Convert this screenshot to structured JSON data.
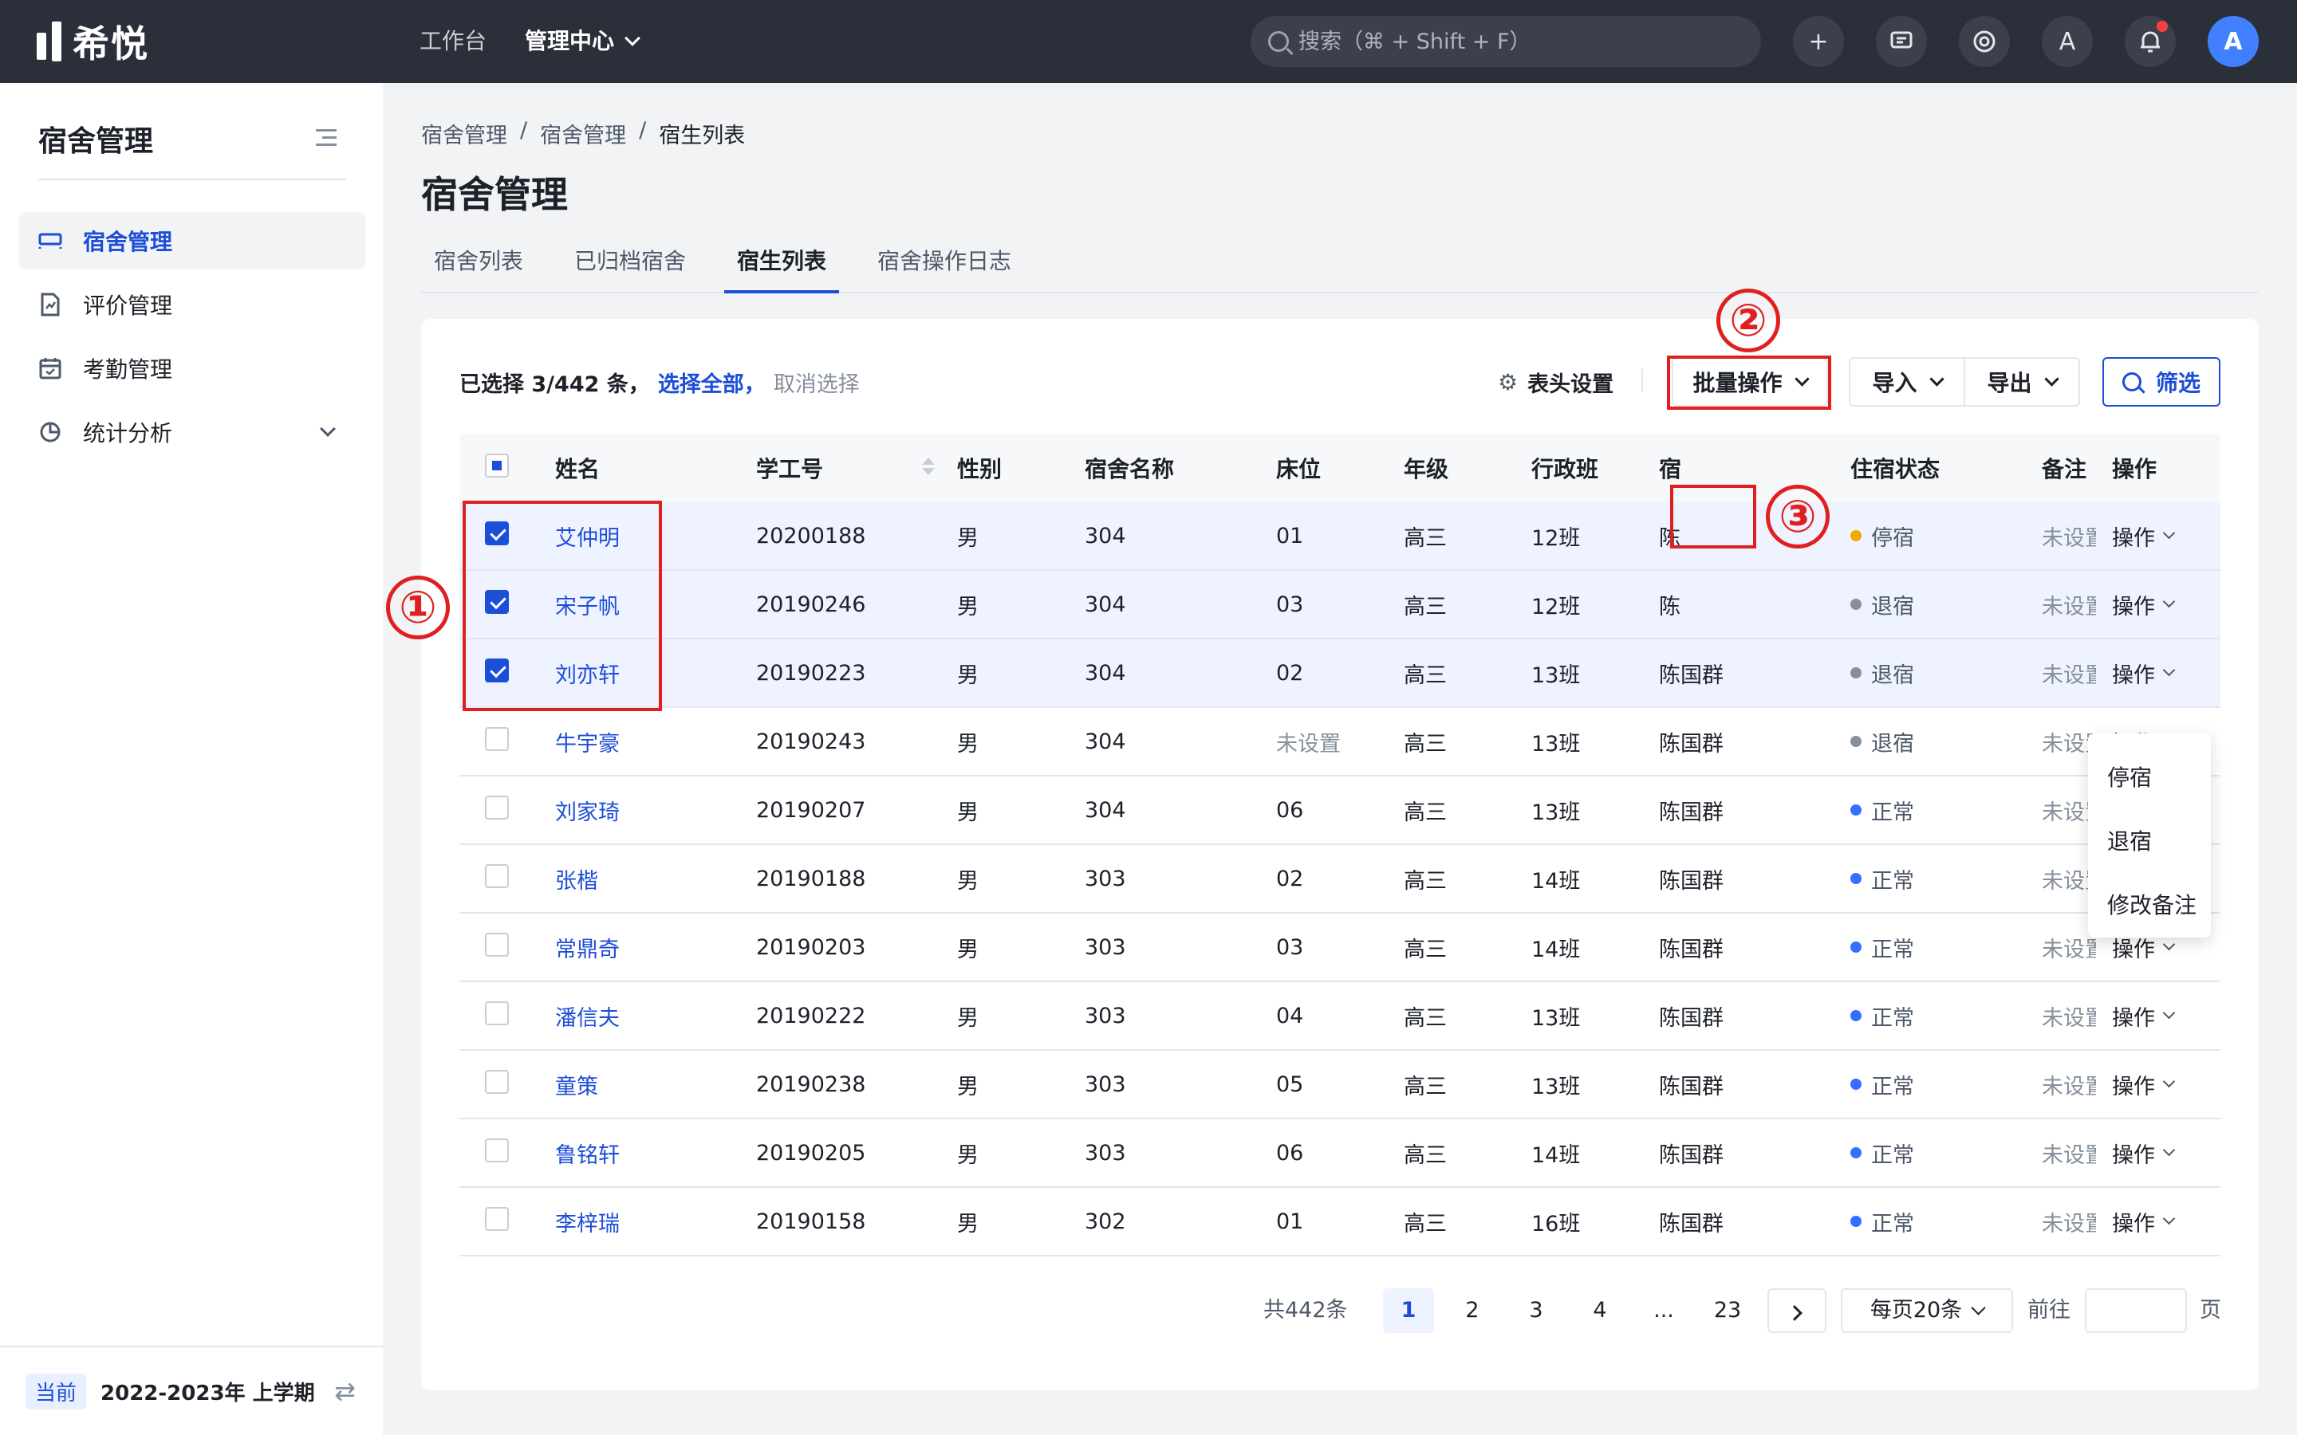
{
  "app": {
    "logo_text": "希悦"
  },
  "topnav": {
    "workbench": "工作台",
    "admin_center": "管理中心"
  },
  "search": {
    "placeholder": "搜索（⌘ + Shift + F）"
  },
  "top_icons": {
    "add": "+",
    "chat": "▭",
    "help": "⊙",
    "translate": "A",
    "bell": "🔔",
    "avatar": "A"
  },
  "sidebar": {
    "title": "宿舍管理",
    "items": [
      {
        "label": "宿舍管理",
        "icon": "bed-icon"
      },
      {
        "label": "评价管理",
        "icon": "evaluation-icon"
      },
      {
        "label": "考勤管理",
        "icon": "calendar-icon"
      },
      {
        "label": "统计分析",
        "icon": "pie-chart-icon"
      }
    ],
    "term_tag": "当前",
    "term_text": "2022-2023年 上学期"
  },
  "breadcrumb": [
    "宿舍管理",
    "宿舍管理",
    "宿生列表"
  ],
  "breadcrumb_sep": "/",
  "page_title": "宿舍管理",
  "tabs": [
    "宿舍列表",
    "已归档宿舍",
    "宿生列表",
    "宿舍操作日志"
  ],
  "toolbar": {
    "selected_count": "已选择 3/442 条，",
    "select_all": "选择全部，",
    "cancel_select": "取消选择",
    "header_settings": "表头设置",
    "batch": "批量操作",
    "import": "导入",
    "export": "导出",
    "filter": "筛选"
  },
  "batch_menu": [
    "停宿",
    "退宿",
    "修改备注"
  ],
  "table": {
    "headers": [
      "姓名",
      "学工号",
      "性别",
      "宿舍名称",
      "床位",
      "年级",
      "行政班",
      "宿",
      "住宿状态",
      "备注",
      "操作"
    ],
    "op_label": "操作",
    "rows": [
      {
        "checked": true,
        "name": "艾仲明",
        "id": "20200188",
        "sex": "男",
        "dorm": "304",
        "bed": "01",
        "grade": "高三",
        "class": "12班",
        "teacher": "陈",
        "status": "停宿",
        "status_type": "paused",
        "note": "未设置"
      },
      {
        "checked": true,
        "name": "宋子帆",
        "id": "20190246",
        "sex": "男",
        "dorm": "304",
        "bed": "03",
        "grade": "高三",
        "class": "12班",
        "teacher": "陈",
        "status": "退宿",
        "status_type": "out",
        "note": "未设置"
      },
      {
        "checked": true,
        "name": "刘亦轩",
        "id": "20190223",
        "sex": "男",
        "dorm": "304",
        "bed": "02",
        "grade": "高三",
        "class": "13班",
        "teacher": "陈国群",
        "status": "退宿",
        "status_type": "out",
        "note": "未设置"
      },
      {
        "checked": false,
        "name": "牛宇豪",
        "id": "20190243",
        "sex": "男",
        "dorm": "304",
        "bed": "未设置",
        "grade": "高三",
        "class": "13班",
        "teacher": "陈国群",
        "status": "退宿",
        "status_type": "out",
        "note": "未设置"
      },
      {
        "checked": false,
        "name": "刘家琦",
        "id": "20190207",
        "sex": "男",
        "dorm": "304",
        "bed": "06",
        "grade": "高三",
        "class": "13班",
        "teacher": "陈国群",
        "status": "正常",
        "status_type": "normal",
        "note": "未设置"
      },
      {
        "checked": false,
        "name": "张楷",
        "id": "20190188",
        "sex": "男",
        "dorm": "303",
        "bed": "02",
        "grade": "高三",
        "class": "14班",
        "teacher": "陈国群",
        "status": "正常",
        "status_type": "normal",
        "note": "未设置"
      },
      {
        "checked": false,
        "name": "常鼎奇",
        "id": "20190203",
        "sex": "男",
        "dorm": "303",
        "bed": "03",
        "grade": "高三",
        "class": "14班",
        "teacher": "陈国群",
        "status": "正常",
        "status_type": "normal",
        "note": "未设置"
      },
      {
        "checked": false,
        "name": "潘信夫",
        "id": "20190222",
        "sex": "男",
        "dorm": "303",
        "bed": "04",
        "grade": "高三",
        "class": "13班",
        "teacher": "陈国群",
        "status": "正常",
        "status_type": "normal",
        "note": "未设置"
      },
      {
        "checked": false,
        "name": "童策",
        "id": "20190238",
        "sex": "男",
        "dorm": "303",
        "bed": "05",
        "grade": "高三",
        "class": "13班",
        "teacher": "陈国群",
        "status": "正常",
        "status_type": "normal",
        "note": "未设置"
      },
      {
        "checked": false,
        "name": "鲁铭轩",
        "id": "20190205",
        "sex": "男",
        "dorm": "303",
        "bed": "06",
        "grade": "高三",
        "class": "14班",
        "teacher": "陈国群",
        "status": "正常",
        "status_type": "normal",
        "note": "未设置"
      },
      {
        "checked": false,
        "name": "李梓瑞",
        "id": "20190158",
        "sex": "男",
        "dorm": "302",
        "bed": "01",
        "grade": "高三",
        "class": "16班",
        "teacher": "陈国群",
        "status": "正常",
        "status_type": "normal",
        "note": "未设置"
      }
    ]
  },
  "pagination": {
    "total": "共442条",
    "pages": [
      "1",
      "2",
      "3",
      "4",
      "...",
      "23"
    ],
    "current": "1",
    "page_size": "每页20条",
    "goto": "前往",
    "unit": "页"
  },
  "annotations": [
    "①",
    "②",
    "③"
  ],
  "colors": {
    "primary": "#1d4ed8",
    "topbar": "#2b2f3a",
    "annotation": "#e02020",
    "paused": "#f7a600",
    "normal": "#3370ff",
    "out": "#86909c"
  }
}
